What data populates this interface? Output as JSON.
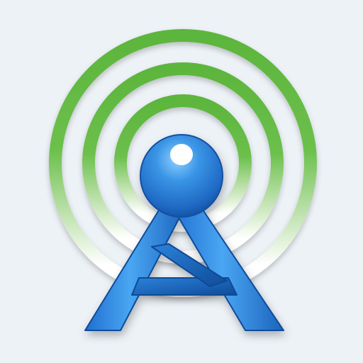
{
  "icon": {
    "name": "radio-tower-broadcast-icon",
    "colors": {
      "background": "#edf2f7",
      "ring_green": "#5cb53c",
      "ring_fade": "#ffffff",
      "tower_blue": "#2f7fd1",
      "tower_highlight": "#7fc2ff",
      "tower_shadow": "#0c3f8f"
    }
  }
}
